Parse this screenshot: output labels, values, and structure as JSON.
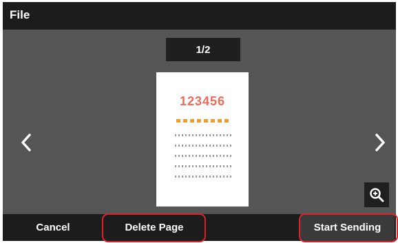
{
  "header": {
    "title": "File"
  },
  "preview": {
    "page_indicator": "1/2",
    "document_number": "123456",
    "document_number_color": "#ee6b5a",
    "dash_color": "#f39a2a",
    "prev_icon": "chevron-left-icon",
    "next_icon": "chevron-right-icon",
    "zoom_icon": "zoom-in-icon"
  },
  "actions": {
    "cancel_label": "Cancel",
    "delete_label": "Delete Page",
    "send_label": "Start Sending"
  },
  "highlight_color": "#e0212b"
}
